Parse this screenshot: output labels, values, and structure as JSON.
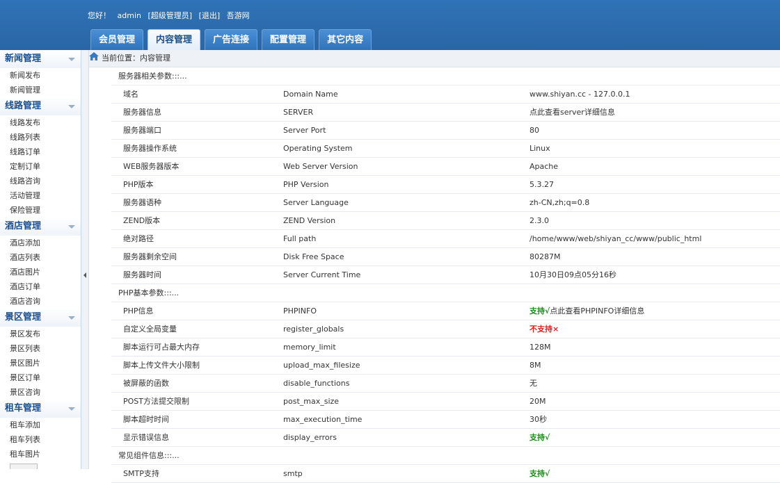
{
  "header": {
    "greeting": "您好！",
    "username": "admin",
    "role": "[超级管理员]",
    "logout": "[退出]",
    "site": "吾游网",
    "tabs": [
      "会员管理",
      "内容管理",
      "广告连接",
      "配置管理",
      "其它内容"
    ],
    "active_tab": 1
  },
  "sidebar": {
    "groups": [
      {
        "title": "新闻管理",
        "items": [
          "新闻发布",
          "新闻管理"
        ]
      },
      {
        "title": "线路管理",
        "items": [
          "线路发布",
          "线路列表",
          "线路订单",
          "定制订单",
          "线路咨询",
          "活动管理",
          "保险管理"
        ]
      },
      {
        "title": "酒店管理",
        "items": [
          "酒店添加",
          "酒店列表",
          "酒店图片",
          "酒店订单",
          "酒店咨询"
        ]
      },
      {
        "title": "景区管理",
        "items": [
          "景区发布",
          "景区列表",
          "景区图片",
          "景区订单",
          "景区咨询"
        ]
      },
      {
        "title": "租车管理",
        "items": [
          "租车添加",
          "租车列表",
          "租车图片"
        ]
      }
    ]
  },
  "breadcrumb": "当前位置：内容管理",
  "sections": [
    {
      "title": "服务器相关参数:::...",
      "rows": [
        [
          "域名",
          "Domain Name",
          "www.shiyan.cc - 127.0.0.1"
        ],
        [
          "服务器信息",
          "SERVER",
          "点此查看server详细信息"
        ],
        [
          "服务器端口",
          "Server Port",
          "80"
        ],
        [
          "服务器操作系统",
          "Operating System",
          "Linux"
        ],
        [
          "WEB服务器版本",
          "Web Server Version",
          "Apache"
        ],
        [
          "PHP版本",
          "PHP Version",
          "5.3.27"
        ],
        [
          "服务器语种",
          "Server Language",
          "zh-CN,zh;q=0.8"
        ],
        [
          "ZEND版本",
          "ZEND Version",
          "2.3.0"
        ],
        [
          "绝对路径",
          "Full path",
          "/home/www/web/shiyan_cc/www/public_html"
        ],
        [
          "服务器剩余空间",
          "Disk Free Space",
          "80287M"
        ],
        [
          "服务器时间",
          "Server Current Time",
          "10月30日09点05分16秒"
        ]
      ]
    },
    {
      "title": "PHP基本参数:::...",
      "rows": [
        [
          "PHP信息",
          "PHPINFO",
          "支持√",
          "点此查看PHPINFO详细信息"
        ],
        [
          "自定义全局变量",
          "register_globals",
          "不支持×"
        ],
        [
          "脚本运行可占最大内存",
          "memory_limit",
          "128M"
        ],
        [
          "脚本上传文件大小限制",
          "upload_max_filesize",
          "8M"
        ],
        [
          "被屏蔽的函数",
          "disable_functions",
          "无"
        ],
        [
          "POST方法提交限制",
          "post_max_size",
          "20M"
        ],
        [
          "脚本超时时间",
          "max_execution_time",
          "30秒"
        ],
        [
          "显示错误信息",
          "display_errors",
          "支持√"
        ]
      ]
    },
    {
      "title": "常见组件信息:::...",
      "rows": [
        [
          "SMTP支持",
          "smtp",
          "支持√"
        ]
      ]
    }
  ],
  "colors": {
    "header": "#2f73b6",
    "ok": "#1c8c1c",
    "no": "#e02020"
  }
}
